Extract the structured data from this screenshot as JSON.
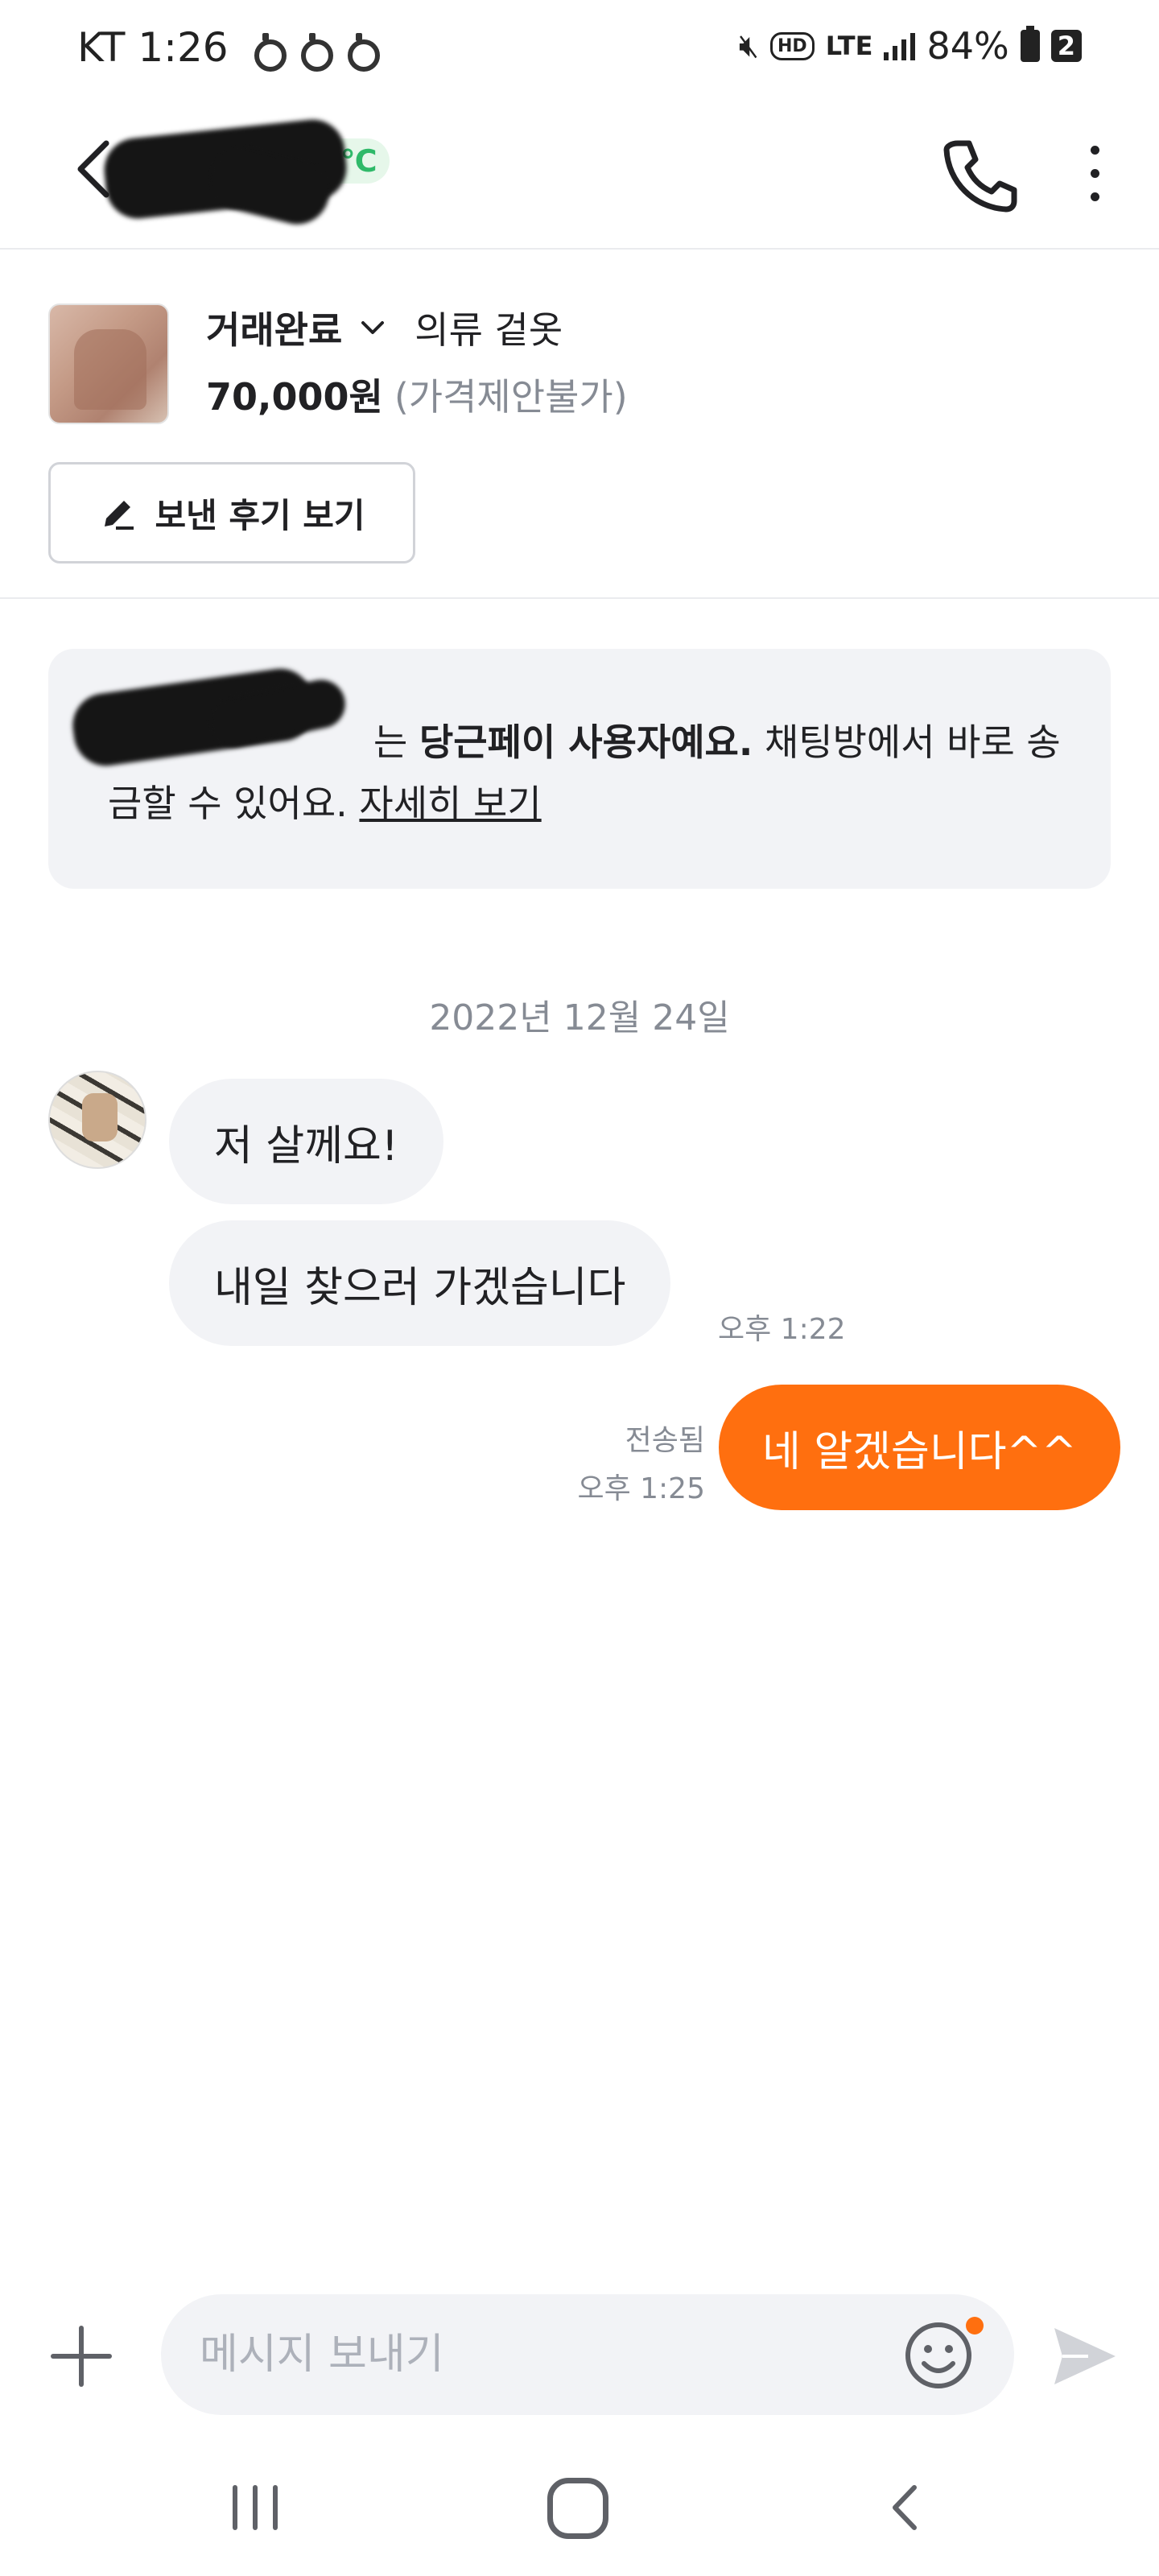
{
  "status_bar": {
    "carrier_time": "KT 1:26",
    "battery": "84%",
    "hd": "HD",
    "lte": "LTE",
    "sim": "2"
  },
  "header": {
    "temperature_badge": "5℃"
  },
  "product": {
    "trade_status": "거래완료",
    "title": "의류 겉옷",
    "price": "70,000원",
    "price_note": "(가격제안불가)",
    "review_button": "보낸 후기 보기"
  },
  "notice": {
    "suffix_particle": "는",
    "bold": "당근페이 사용자예요.",
    "text": "채팅방에서 바로 송금할 수 있어요.",
    "link": "자세히 보기"
  },
  "chat": {
    "date": "2022년 12월 24일",
    "messages": [
      {
        "sender": "other",
        "text": "저 살께요!"
      },
      {
        "sender": "other",
        "text": "내일 찾으러 가겠습니다",
        "time": "오후 1:22"
      },
      {
        "sender": "me",
        "text": "네 알겠습니다^^",
        "status": "전송됨",
        "time": "오후 1:25"
      }
    ]
  },
  "input": {
    "placeholder": "메시지 보내기"
  },
  "colors": {
    "accent": "#ff6f0f",
    "bubble_in": "#f2f3f6",
    "muted_text": "#868b94",
    "temperature": "#2fb969"
  },
  "icons": {
    "back": "chevron-left-icon",
    "call": "phone-icon",
    "more": "more-vertical-icon",
    "review": "pencil-icon",
    "attach": "plus-icon",
    "emoji": "smiley-icon",
    "send": "send-icon"
  }
}
